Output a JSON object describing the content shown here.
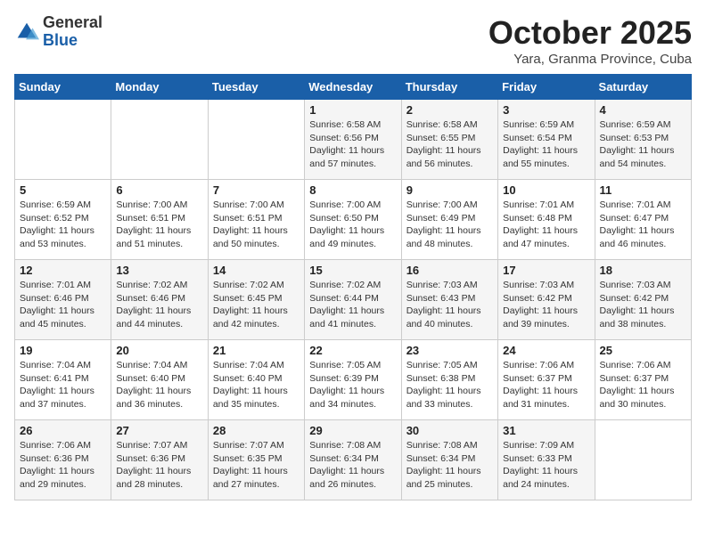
{
  "header": {
    "logo": {
      "general": "General",
      "blue": "Blue"
    },
    "title": "October 2025",
    "location": "Yara, Granma Province, Cuba"
  },
  "days_of_week": [
    "Sunday",
    "Monday",
    "Tuesday",
    "Wednesday",
    "Thursday",
    "Friday",
    "Saturday"
  ],
  "weeks": [
    [
      {
        "day": "",
        "info": ""
      },
      {
        "day": "",
        "info": ""
      },
      {
        "day": "",
        "info": ""
      },
      {
        "day": "1",
        "info": "Sunrise: 6:58 AM\nSunset: 6:56 PM\nDaylight: 11 hours\nand 57 minutes."
      },
      {
        "day": "2",
        "info": "Sunrise: 6:58 AM\nSunset: 6:55 PM\nDaylight: 11 hours\nand 56 minutes."
      },
      {
        "day": "3",
        "info": "Sunrise: 6:59 AM\nSunset: 6:54 PM\nDaylight: 11 hours\nand 55 minutes."
      },
      {
        "day": "4",
        "info": "Sunrise: 6:59 AM\nSunset: 6:53 PM\nDaylight: 11 hours\nand 54 minutes."
      }
    ],
    [
      {
        "day": "5",
        "info": "Sunrise: 6:59 AM\nSunset: 6:52 PM\nDaylight: 11 hours\nand 53 minutes."
      },
      {
        "day": "6",
        "info": "Sunrise: 7:00 AM\nSunset: 6:51 PM\nDaylight: 11 hours\nand 51 minutes."
      },
      {
        "day": "7",
        "info": "Sunrise: 7:00 AM\nSunset: 6:51 PM\nDaylight: 11 hours\nand 50 minutes."
      },
      {
        "day": "8",
        "info": "Sunrise: 7:00 AM\nSunset: 6:50 PM\nDaylight: 11 hours\nand 49 minutes."
      },
      {
        "day": "9",
        "info": "Sunrise: 7:00 AM\nSunset: 6:49 PM\nDaylight: 11 hours\nand 48 minutes."
      },
      {
        "day": "10",
        "info": "Sunrise: 7:01 AM\nSunset: 6:48 PM\nDaylight: 11 hours\nand 47 minutes."
      },
      {
        "day": "11",
        "info": "Sunrise: 7:01 AM\nSunset: 6:47 PM\nDaylight: 11 hours\nand 46 minutes."
      }
    ],
    [
      {
        "day": "12",
        "info": "Sunrise: 7:01 AM\nSunset: 6:46 PM\nDaylight: 11 hours\nand 45 minutes."
      },
      {
        "day": "13",
        "info": "Sunrise: 7:02 AM\nSunset: 6:46 PM\nDaylight: 11 hours\nand 44 minutes."
      },
      {
        "day": "14",
        "info": "Sunrise: 7:02 AM\nSunset: 6:45 PM\nDaylight: 11 hours\nand 42 minutes."
      },
      {
        "day": "15",
        "info": "Sunrise: 7:02 AM\nSunset: 6:44 PM\nDaylight: 11 hours\nand 41 minutes."
      },
      {
        "day": "16",
        "info": "Sunrise: 7:03 AM\nSunset: 6:43 PM\nDaylight: 11 hours\nand 40 minutes."
      },
      {
        "day": "17",
        "info": "Sunrise: 7:03 AM\nSunset: 6:42 PM\nDaylight: 11 hours\nand 39 minutes."
      },
      {
        "day": "18",
        "info": "Sunrise: 7:03 AM\nSunset: 6:42 PM\nDaylight: 11 hours\nand 38 minutes."
      }
    ],
    [
      {
        "day": "19",
        "info": "Sunrise: 7:04 AM\nSunset: 6:41 PM\nDaylight: 11 hours\nand 37 minutes."
      },
      {
        "day": "20",
        "info": "Sunrise: 7:04 AM\nSunset: 6:40 PM\nDaylight: 11 hours\nand 36 minutes."
      },
      {
        "day": "21",
        "info": "Sunrise: 7:04 AM\nSunset: 6:40 PM\nDaylight: 11 hours\nand 35 minutes."
      },
      {
        "day": "22",
        "info": "Sunrise: 7:05 AM\nSunset: 6:39 PM\nDaylight: 11 hours\nand 34 minutes."
      },
      {
        "day": "23",
        "info": "Sunrise: 7:05 AM\nSunset: 6:38 PM\nDaylight: 11 hours\nand 33 minutes."
      },
      {
        "day": "24",
        "info": "Sunrise: 7:06 AM\nSunset: 6:37 PM\nDaylight: 11 hours\nand 31 minutes."
      },
      {
        "day": "25",
        "info": "Sunrise: 7:06 AM\nSunset: 6:37 PM\nDaylight: 11 hours\nand 30 minutes."
      }
    ],
    [
      {
        "day": "26",
        "info": "Sunrise: 7:06 AM\nSunset: 6:36 PM\nDaylight: 11 hours\nand 29 minutes."
      },
      {
        "day": "27",
        "info": "Sunrise: 7:07 AM\nSunset: 6:36 PM\nDaylight: 11 hours\nand 28 minutes."
      },
      {
        "day": "28",
        "info": "Sunrise: 7:07 AM\nSunset: 6:35 PM\nDaylight: 11 hours\nand 27 minutes."
      },
      {
        "day": "29",
        "info": "Sunrise: 7:08 AM\nSunset: 6:34 PM\nDaylight: 11 hours\nand 26 minutes."
      },
      {
        "day": "30",
        "info": "Sunrise: 7:08 AM\nSunset: 6:34 PM\nDaylight: 11 hours\nand 25 minutes."
      },
      {
        "day": "31",
        "info": "Sunrise: 7:09 AM\nSunset: 6:33 PM\nDaylight: 11 hours\nand 24 minutes."
      },
      {
        "day": "",
        "info": ""
      }
    ]
  ]
}
